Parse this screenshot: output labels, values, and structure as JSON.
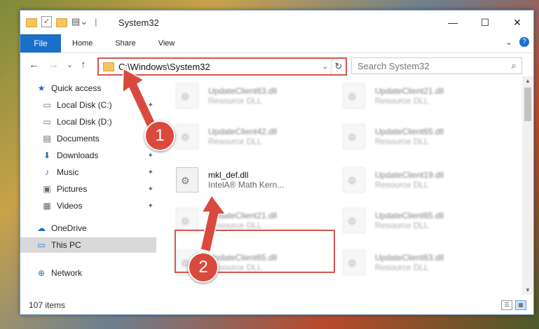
{
  "window": {
    "title": "System32",
    "quick_access_toolbar": [
      "folder-icon",
      "properties-check-icon",
      "new-folder-icon",
      "customize-icon"
    ],
    "controls": {
      "minimize": "—",
      "maximize": "☐",
      "close": "✕"
    }
  },
  "ribbon": {
    "tabs": [
      "File",
      "Home",
      "Share",
      "View"
    ],
    "expand_glyph": "⌄",
    "help_glyph": "?"
  },
  "nav": {
    "back": "←",
    "forward": "→",
    "recent": "⌄",
    "up": "↑",
    "address": "C:\\Windows\\System32",
    "address_dropdown": "⌄",
    "refresh": "↻",
    "search_placeholder": "Search System32"
  },
  "sidebar": {
    "items": [
      {
        "label": "Quick access",
        "icon": "star-icon",
        "pinned": false,
        "selected": false
      },
      {
        "label": "Local Disk (C:)",
        "icon": "drive-icon",
        "pinned": true,
        "selected": false
      },
      {
        "label": "Local Disk (D:)",
        "icon": "drive-icon",
        "pinned": true,
        "selected": false
      },
      {
        "label": "Documents",
        "icon": "documents-icon",
        "pinned": true,
        "selected": false
      },
      {
        "label": "Downloads",
        "icon": "download-icon",
        "pinned": true,
        "selected": false
      },
      {
        "label": "Music",
        "icon": "music-icon",
        "pinned": true,
        "selected": false
      },
      {
        "label": "Pictures",
        "icon": "pictures-icon",
        "pinned": true,
        "selected": false
      },
      {
        "label": "Videos",
        "icon": "videos-icon",
        "pinned": true,
        "selected": false
      },
      {
        "label": "OneDrive",
        "icon": "cloud-icon",
        "pinned": false,
        "selected": false
      },
      {
        "label": "This PC",
        "icon": "computer-icon",
        "pinned": false,
        "selected": true
      },
      {
        "label": "Network",
        "icon": "network-icon",
        "pinned": false,
        "selected": false
      }
    ]
  },
  "files": [
    {
      "name": "UpdateClient63.dll",
      "desc": "Resource DLL",
      "blurred": true
    },
    {
      "name": "UpdateClient21.dll",
      "desc": "Resource DLL",
      "blurred": true
    },
    {
      "name": "UpdateClient42.dll",
      "desc": "Resource DLL",
      "blurred": true
    },
    {
      "name": "UpdateClient65.dll",
      "desc": "Resource DLL",
      "blurred": true
    },
    {
      "name": "mkl_def.dll",
      "desc": "IntelA® Math Kern...",
      "blurred": false
    },
    {
      "name": "UpdateClient19.dll",
      "desc": "Resource DLL",
      "blurred": true
    },
    {
      "name": "UpdateClient21.dll",
      "desc": "Resource DLL",
      "blurred": true
    },
    {
      "name": "UpdateClient65.dll",
      "desc": "Resource DLL",
      "blurred": true
    },
    {
      "name": "UpdateClient65.dll",
      "desc": "Resource DLL",
      "blurred": true
    },
    {
      "name": "UpdateClient63.dll",
      "desc": "Resource DLL",
      "blurred": true
    }
  ],
  "status": {
    "item_count": "107 items"
  },
  "annotations": {
    "step1": "1",
    "step2": "2",
    "accent_color": "#d94a3d"
  }
}
